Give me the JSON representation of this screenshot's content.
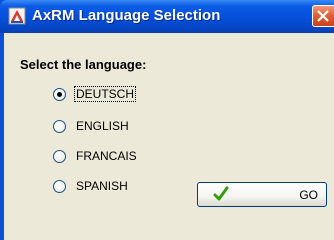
{
  "window": {
    "title": "AxRM Language Selection",
    "app_icon": "axrm-app-icon",
    "close_icon": "close-icon"
  },
  "prompt": "Select the language:",
  "options": [
    {
      "label": "DEUTSCH",
      "checked": true
    },
    {
      "label": "ENGLISH",
      "checked": false
    },
    {
      "label": "FRANCAIS",
      "checked": false
    },
    {
      "label": "SPANISH",
      "checked": false
    }
  ],
  "go_button": {
    "label": "GO",
    "icon": "checkmark-icon"
  },
  "colors": {
    "titlebar": "#0550dc",
    "client_bg": "#ece9d8",
    "close_button": "#e2613b",
    "check_green": "#3a9a12"
  }
}
